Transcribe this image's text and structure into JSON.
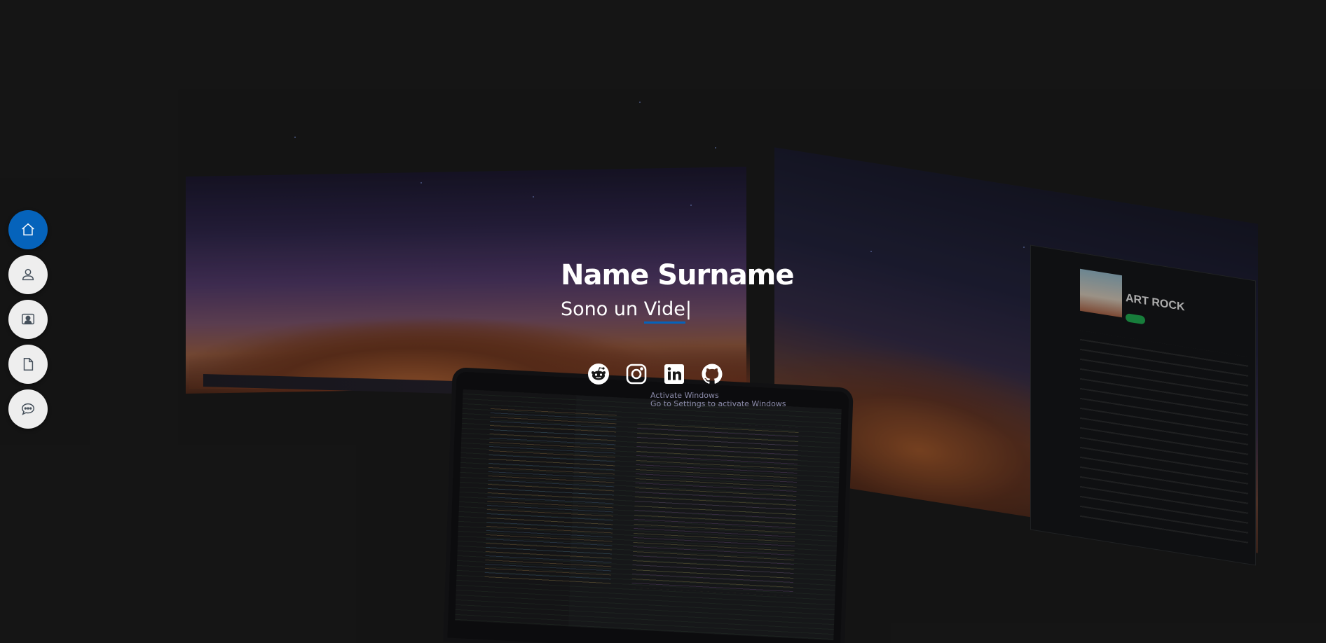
{
  "hero": {
    "name": "Name Surname",
    "subtitle_prefix": "Sono un ",
    "subtitle_typed": "Vide",
    "cursor": "|"
  },
  "nav": {
    "items": [
      {
        "icon": "home-icon",
        "active": true
      },
      {
        "icon": "user-icon",
        "active": false
      },
      {
        "icon": "portfolio-icon",
        "active": false
      },
      {
        "icon": "file-icon",
        "active": false
      },
      {
        "icon": "chat-icon",
        "active": false
      }
    ]
  },
  "social": {
    "items": [
      "reddit-icon",
      "instagram-icon",
      "linkedin-icon",
      "github-icon"
    ]
  },
  "background_overlay": {
    "activate_title": "Activate Windows",
    "activate_sub": "Go to Settings to activate Windows",
    "album_title": "ART ROCK"
  },
  "colors": {
    "accent": "#0563bb",
    "page_bg": "#181818",
    "nav_bg": "#eeeeee"
  }
}
